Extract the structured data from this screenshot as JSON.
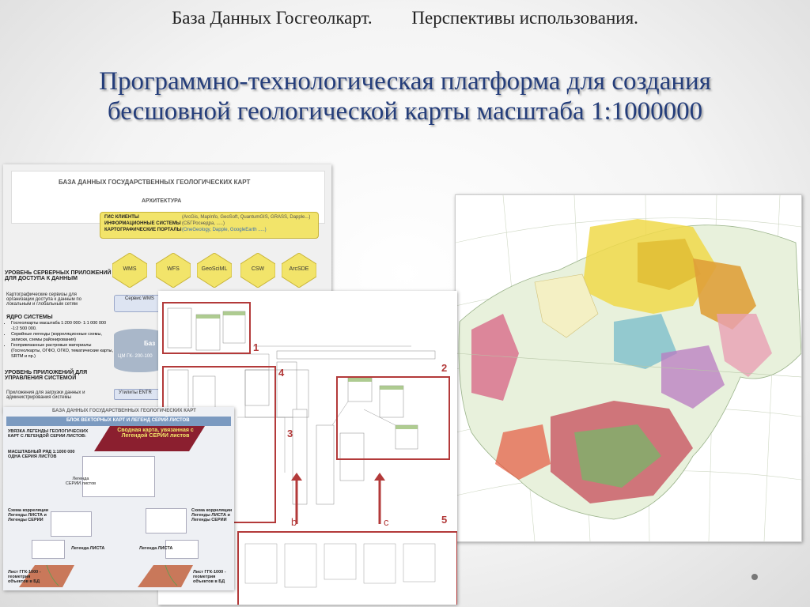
{
  "header": {
    "left": "База Данных Госгеолкарт.",
    "right": "Перспективы использования."
  },
  "title": {
    "line1": "Программно-технологическая платформа для создания",
    "line2": "бесшовной геологической карты масштаба 1:1000000"
  },
  "arch": {
    "heading": "БАЗА ДАННЫХ ГОСУДАРСТВЕННЫХ ГЕОЛОГИЧЕСКИХ КАРТ",
    "subheading": "АРХИТЕКТУРА",
    "gis_label": "ГИС КЛИЕНТЫ",
    "gis_value": "(ArcGis, MapInfo, GeoSoft, QuantumGIS, GRASS, Dapple...)",
    "info_label": "ИНФОРМАЦИОННЫЕ СИСТЕМЫ",
    "info_value": "(СБГРоснедра, .....)",
    "portal_label": "КАРТОГРАФИЧЕСКИЕ ПОРТАЛЫ",
    "portal_value": "(OneGeology, Dapple, GoogleEarth .....)",
    "services": [
      "WMS",
      "WFS",
      "GeoSciML",
      "CSW",
      "ArcSDE"
    ],
    "level1": "УРОВЕНЬ СЕРВЕРНЫХ ПРИЛОЖЕНИЙ ДЛЯ ДОСТУПА К ДАННЫМ",
    "level1_desc": "Картографические сервизы для организации доступа к данным по локальным и глобальным сетям",
    "core": "ЯДРО СИСТЕМЫ",
    "core_items": [
      "Госгеолкарты масштаба 1:200 000- 1:1 000 000 -1:2 500 000.",
      "Серийные легенды (корреляционные схемы, записки, схемы районирования)",
      "Геопривязанные растровые материалы (Госгеолкарты, ОГФО, ОГКО, тематические карты, SRTM и пр.)"
    ],
    "level2": "УРОВЕНЬ ПРИЛОЖЕНИЙ ДЛЯ УПРАВЛЕНИЯ СИСТЕМОЙ",
    "level2_desc": "Приложения для загрузки данных и администрирования системы",
    "service_box": "Сервис WMS",
    "db_label": "ЦМ ГК- 200-100",
    "db_top": "Баз",
    "utils": "Утилиты ENTR"
  },
  "schema": {
    "labels": [
      "1",
      "2",
      "3",
      "4",
      "5",
      "b",
      "c"
    ]
  },
  "vec": {
    "heading": "БАЗА ДАННЫХ ГОСУДАРСТВЕННЫХ ГЕОЛОГИЧЕСКИХ КАРТ",
    "subheading": "БЛОК ВЕКТОРНЫХ КАРТ И ЛЕГЕНД СЕРИЙ ЛИСТОВ",
    "intro": "УВЯЗКА ЛЕГЕНДЫ ГЕОЛОГИЧЕСКИХ КАРТ С ЛЕГЕНДОЙ СЕРИИ ЛИСТОВ:",
    "banner": "Сводная карта, увязанная с Легендой СЕРИИ листов",
    "scale": "МАСШТАБНЫЙ РЯД 1:1000 000 ОДНА СЕРИЯ ЛИСТОВ",
    "legend_series": "Легенда СЕРИИ листов",
    "corr_left": "Схема корреляции Легенды ЛИСТА и Легенды СЕРИИ",
    "corr_right": "Схема корреляции Легенды ЛИСТА и Легенды СЕРИИ",
    "legend_left": "Легенда ЛИСТА",
    "legend_right": "Легенда ЛИСТА",
    "sheet_left": "Лист ГГК-1000 - геометрия объектов в БД",
    "sheet_right": "Лист ГГК-1000 - геометрия объектов в БД"
  },
  "colors": {
    "title": "#243d7a",
    "frame": "#b33a3a",
    "yellow": "#f2e46a"
  }
}
